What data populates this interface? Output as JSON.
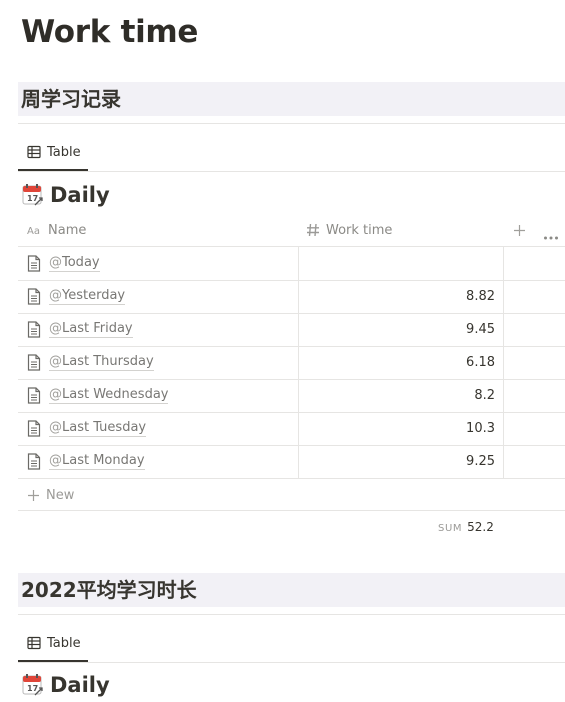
{
  "page": {
    "title": "Work time"
  },
  "sections": [
    {
      "heading": "周学习记录",
      "tab_label": "Table",
      "view_title": "Daily",
      "columns": {
        "name": "Name",
        "work_time": "Work time"
      },
      "rows": [
        {
          "at": "@",
          "label": "Today",
          "value": ""
        },
        {
          "at": "@",
          "label": "Yesterday",
          "value": "8.82"
        },
        {
          "at": "@",
          "label": "Last Friday",
          "value": "9.45"
        },
        {
          "at": "@",
          "label": "Last Thursday",
          "value": "6.18"
        },
        {
          "at": "@",
          "label": "Last Wednesday",
          "value": "8.2"
        },
        {
          "at": "@",
          "label": "Last Tuesday",
          "value": "10.3"
        },
        {
          "at": "@",
          "label": "Last Monday",
          "value": "9.25"
        }
      ],
      "new_label": "New",
      "sum_label": "SUM",
      "sum_value": "52.2"
    },
    {
      "heading": "2022平均学习时长",
      "tab_label": "Table",
      "view_title": "Daily"
    }
  ],
  "icons": {
    "table": "table-icon",
    "calendar": "calendar-icon",
    "text_property": "text-property-icon",
    "number_property": "hash-icon",
    "add": "plus-icon",
    "more": "more-horizontal-icon",
    "page": "page-icon"
  },
  "colors": {
    "section_bg": "#f2f1f6",
    "text": "#37352f",
    "muted": "#9b9a97"
  }
}
